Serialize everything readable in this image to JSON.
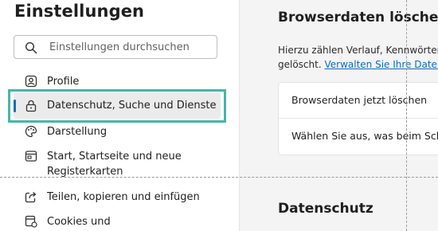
{
  "sidebar": {
    "title": "Einstellungen",
    "search": {
      "placeholder": "Einstellungen durchsuchen",
      "icon": "search-icon"
    },
    "items": [
      {
        "label": "Profile",
        "icon": "profile-icon",
        "active": false
      },
      {
        "label": "Datenschutz, Suche und Dienste",
        "icon": "lock-icon",
        "active": true
      },
      {
        "label": "Darstellung",
        "icon": "appearance-icon",
        "active": false
      },
      {
        "label": "Start, Startseite und neue\nRegisterkarten",
        "icon": "start-icon",
        "active": false
      },
      {
        "label": "Teilen, kopieren und einfügen",
        "icon": "share-icon",
        "active": false
      },
      {
        "label": "Cookies und",
        "icon": "cookies-icon",
        "active": false
      }
    ]
  },
  "main": {
    "title": "Browserdaten löschen",
    "description_line1": "Hierzu zählen Verlauf, Kennwörter,",
    "description_line2_prefix": "gelöscht. ",
    "description_link": "Verwalten Sie Ihre Daten",
    "card_rows": [
      "Browserdaten jetzt löschen",
      "Wählen Sie aus, was beim Schließen"
    ],
    "section_title": "Datenschutz"
  },
  "colors": {
    "accent": "#0f6cbd",
    "highlight": "#44b6a8",
    "main_bg": "#f4f4f4"
  }
}
